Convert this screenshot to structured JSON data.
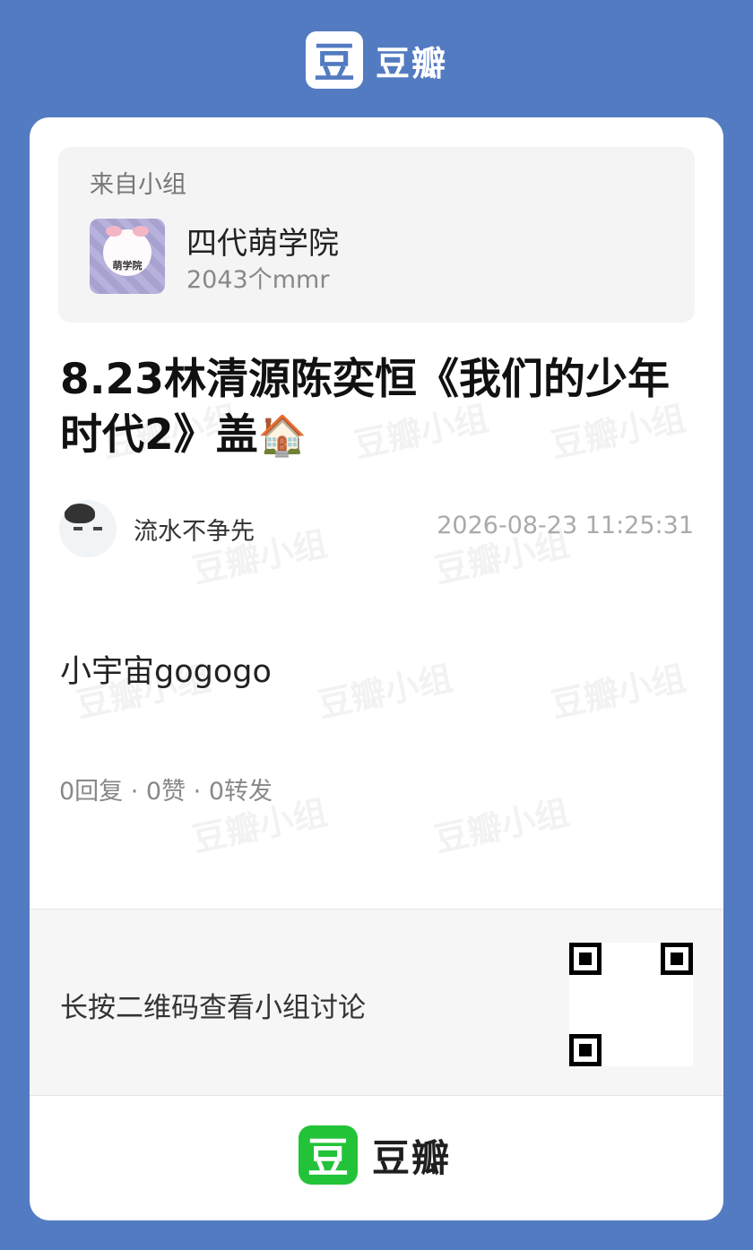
{
  "brand": {
    "logo_char": "豆",
    "name": "豆瓣"
  },
  "watermark_text": "豆瓣小组",
  "group": {
    "from_label": "来自小组",
    "avatar_label": "萌学院",
    "name": "四代萌学院",
    "member_count": "2043个mmr"
  },
  "post": {
    "title": "8.23林清源陈奕恒《我们的少年时代2》盖",
    "title_emoji": "🏠",
    "author": "流水不争先",
    "time": "2026-08-23 11:25:31",
    "body": "小宇宙gogogo",
    "stats": "0回复 · 0赞 · 0转发"
  },
  "qr": {
    "prompt": "长按二维码查看小组讨论"
  },
  "colors": {
    "background": "#537bc1",
    "card": "#ffffff",
    "footer_logo": "#22c338"
  }
}
